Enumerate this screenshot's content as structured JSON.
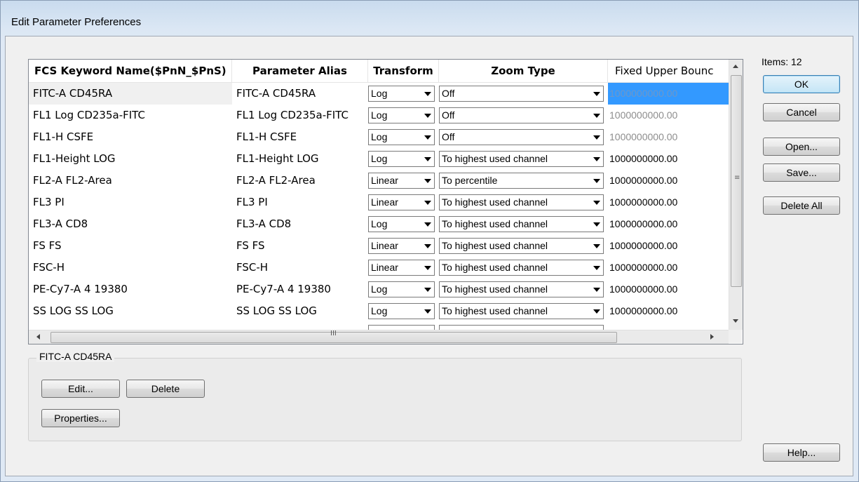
{
  "window": {
    "title": "Edit Parameter Preferences"
  },
  "grid": {
    "columns": [
      "FCS Keyword Name($PnN_$PnS)",
      "Parameter Alias",
      "Transform",
      "Zoom Type",
      "Fixed Upper Bounc"
    ],
    "rows": [
      {
        "name": "FITC-A CD45RA",
        "alias": "FITC-A CD45RA",
        "transform": "Log",
        "zoom": "Off",
        "upper": "1000000000.00"
      },
      {
        "name": "FL1 Log CD235a-FITC",
        "alias": "FL1 Log CD235a-FITC",
        "transform": "Log",
        "zoom": "Off",
        "upper": "1000000000.00"
      },
      {
        "name": "FL1-H CSFE",
        "alias": "FL1-H CSFE",
        "transform": "Log",
        "zoom": "Off",
        "upper": "1000000000.00"
      },
      {
        "name": "FL1-Height LOG",
        "alias": "FL1-Height LOG",
        "transform": "Log",
        "zoom": "To highest used channel",
        "upper": "1000000000.00"
      },
      {
        "name": "FL2-A FL2-Area",
        "alias": "FL2-A FL2-Area",
        "transform": "Linear",
        "zoom": "To percentile",
        "upper": "1000000000.00"
      },
      {
        "name": "FL3 PI",
        "alias": "FL3 PI",
        "transform": "Linear",
        "zoom": "To highest used channel",
        "upper": "1000000000.00"
      },
      {
        "name": "FL3-A CD8",
        "alias": "FL3-A CD8",
        "transform": "Log",
        "zoom": "To highest used channel",
        "upper": "1000000000.00"
      },
      {
        "name": "FS FS",
        "alias": "FS FS",
        "transform": "Linear",
        "zoom": "To highest used channel",
        "upper": "1000000000.00"
      },
      {
        "name": "FSC-H",
        "alias": "FSC-H",
        "transform": "Linear",
        "zoom": "To highest used channel",
        "upper": "1000000000.00"
      },
      {
        "name": "PE-Cy7-A 4 19380",
        "alias": "PE-Cy7-A 4 19380",
        "transform": "Log",
        "zoom": "To highest used channel",
        "upper": "1000000000.00"
      },
      {
        "name": "SS LOG SS LOG",
        "alias": "SS LOG SS LOG",
        "transform": "Log",
        "zoom": "To highest used channel",
        "upper": "1000000000.00"
      }
    ],
    "vscroll_grip": "≡",
    "hscroll_grip": "III"
  },
  "side": {
    "items_label": "Items: 12",
    "ok": "OK",
    "cancel": "Cancel",
    "open": "Open...",
    "save": "Save...",
    "delete_all": "Delete All",
    "help": "Help..."
  },
  "group": {
    "label": "FITC-A CD45RA",
    "edit": "Edit...",
    "delete": "Delete",
    "properties": "Properties..."
  },
  "colors": {
    "selection": "#3399ff",
    "disabled_text": "#8d8d8d",
    "default_button_border": "#3c7fb1"
  },
  "icons": [
    "combo-arrow-icon",
    "scroll-up-arrow-icon",
    "scroll-down-arrow-icon",
    "scroll-left-arrow-icon",
    "scroll-right-arrow-icon"
  ]
}
